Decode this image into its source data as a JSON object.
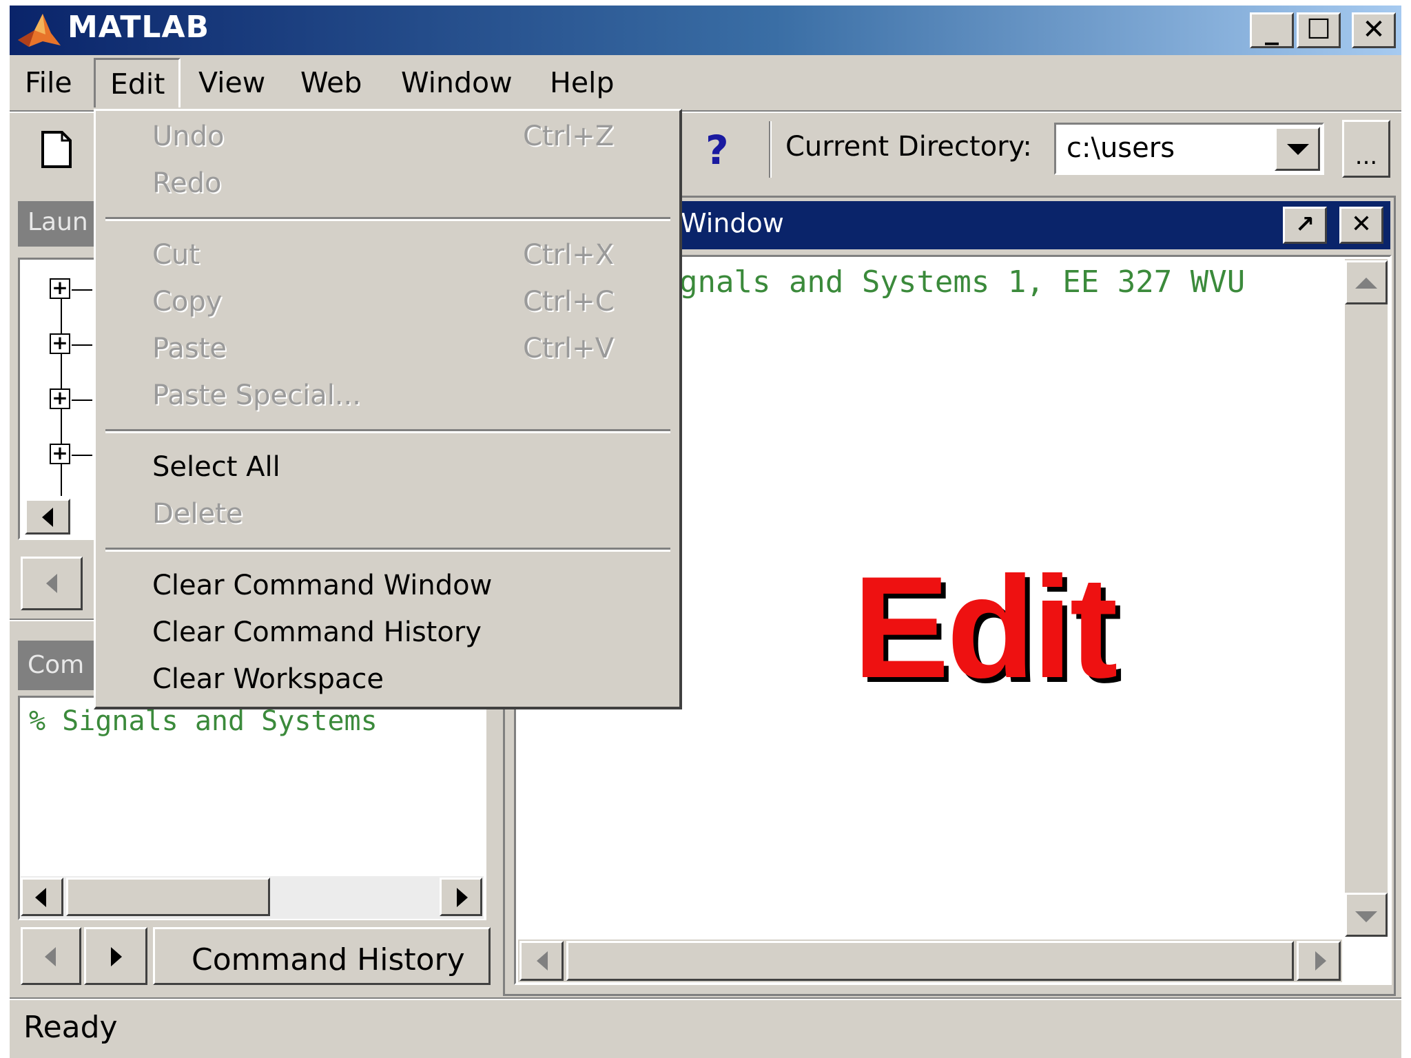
{
  "window": {
    "title": "MATLAB",
    "min_glyph": "_",
    "max_glyph": "☐",
    "close_glyph": "✕"
  },
  "menubar": {
    "items": [
      "File",
      "Edit",
      "View",
      "Web",
      "Window",
      "Help"
    ]
  },
  "toolbar": {
    "help_glyph": "?",
    "current_dir_label": "Current Directory:",
    "current_dir_value": "c:\\users",
    "browse_label": "..."
  },
  "launch_pad": {
    "title_partial": "Laun"
  },
  "command_history": {
    "title_partial": "Com",
    "line": "% Signals and Systems",
    "tab_label": "Command History"
  },
  "command_window": {
    "title_partial": "Window",
    "line_partial": "gnals and Systems 1, EE 327 WVU"
  },
  "edit_menu": {
    "undo": "Undo",
    "undo_shortcut": "Ctrl+Z",
    "redo": "Redo",
    "cut": "Cut",
    "cut_shortcut": "Ctrl+X",
    "copy": "Copy",
    "copy_shortcut": "Ctrl+C",
    "paste": "Paste",
    "paste_shortcut": "Ctrl+V",
    "paste_special": "Paste Special...",
    "select_all": "Select All",
    "delete": "Delete",
    "clear_command_window": "Clear Command Window",
    "clear_command_history": "Clear Command History",
    "clear_workspace": "Clear Workspace"
  },
  "overlay_text": "Edit",
  "status": {
    "text": "Ready"
  },
  "colors": {
    "titlebar_start": "#0a246a",
    "titlebar_end": "#a6caf0",
    "chrome": "#d4d0c8",
    "code_green": "#3b8a3b",
    "overlay_red": "#ee1111"
  }
}
